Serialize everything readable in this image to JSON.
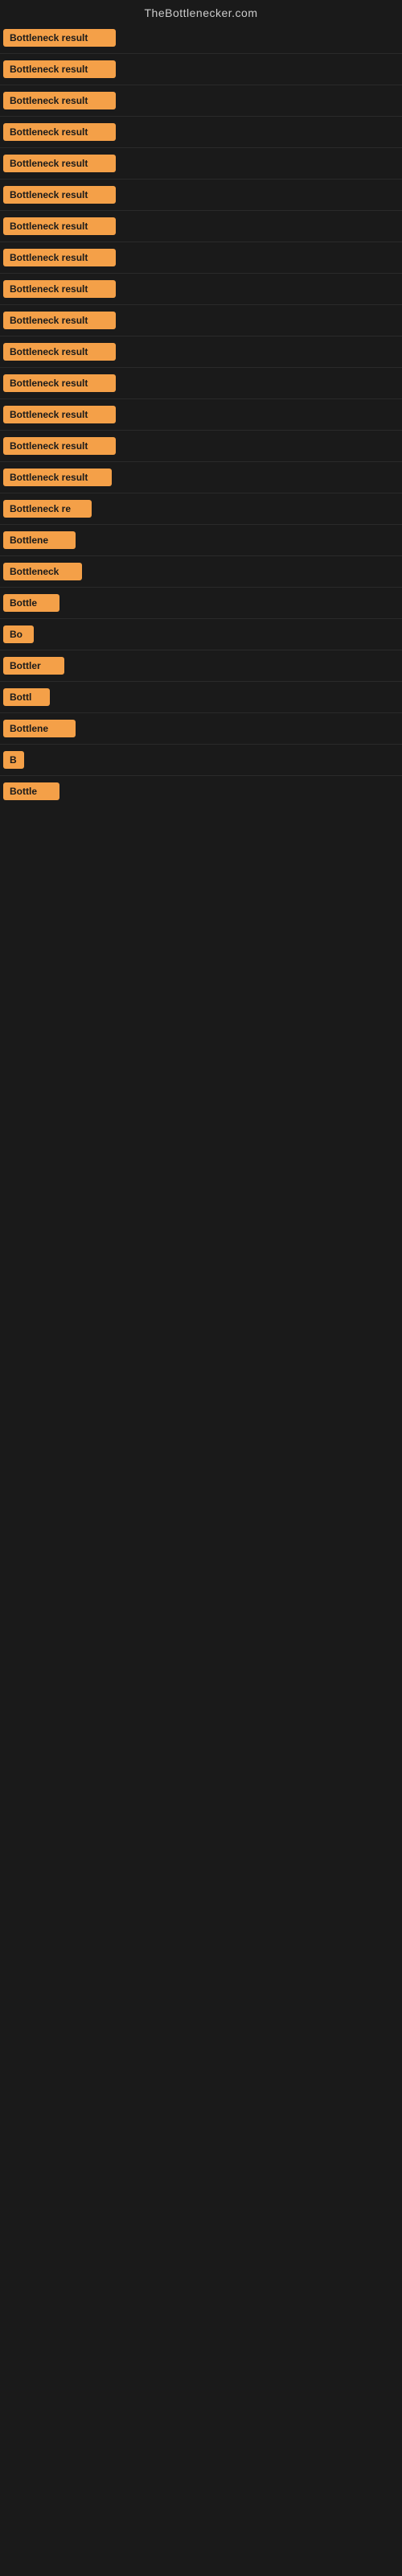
{
  "site": {
    "title": "TheBottlenecker.com"
  },
  "results": [
    {
      "id": 1,
      "label": "Bottleneck result",
      "width": "full"
    },
    {
      "id": 2,
      "label": "Bottleneck result",
      "width": "full"
    },
    {
      "id": 3,
      "label": "Bottleneck result",
      "width": "full"
    },
    {
      "id": 4,
      "label": "Bottleneck result",
      "width": "full"
    },
    {
      "id": 5,
      "label": "Bottleneck result",
      "width": "full"
    },
    {
      "id": 6,
      "label": "Bottleneck result",
      "width": "full"
    },
    {
      "id": 7,
      "label": "Bottleneck result",
      "width": "full"
    },
    {
      "id": 8,
      "label": "Bottleneck result",
      "width": "full"
    },
    {
      "id": 9,
      "label": "Bottleneck result",
      "width": "full"
    },
    {
      "id": 10,
      "label": "Bottleneck result",
      "width": "full"
    },
    {
      "id": 11,
      "label": "Bottleneck result",
      "width": "full"
    },
    {
      "id": 12,
      "label": "Bottleneck result",
      "width": "full"
    },
    {
      "id": 13,
      "label": "Bottleneck result",
      "width": "full"
    },
    {
      "id": 14,
      "label": "Bottleneck result",
      "width": "full"
    },
    {
      "id": 15,
      "label": "Bottleneck result",
      "width": "partial-95"
    },
    {
      "id": 16,
      "label": "Bottleneck re",
      "width": "partial-80"
    },
    {
      "id": 17,
      "label": "Bottlene",
      "width": "partial-65"
    },
    {
      "id": 18,
      "label": "Bottleneck",
      "width": "partial-70"
    },
    {
      "id": 19,
      "label": "Bottle",
      "width": "partial-50"
    },
    {
      "id": 20,
      "label": "Bo",
      "width": "partial-25"
    },
    {
      "id": 21,
      "label": "Bottler",
      "width": "partial-55"
    },
    {
      "id": 22,
      "label": "Bottl",
      "width": "partial-42"
    },
    {
      "id": 23,
      "label": "Bottlene",
      "width": "partial-65"
    },
    {
      "id": 24,
      "label": "B",
      "width": "partial-18"
    },
    {
      "id": 25,
      "label": "Bottle",
      "width": "partial-50"
    }
  ],
  "colors": {
    "badge_bg": "#f4a048",
    "body_bg": "#1a1a1a",
    "title_color": "#cccccc",
    "badge_text": "#1a1a1a"
  }
}
